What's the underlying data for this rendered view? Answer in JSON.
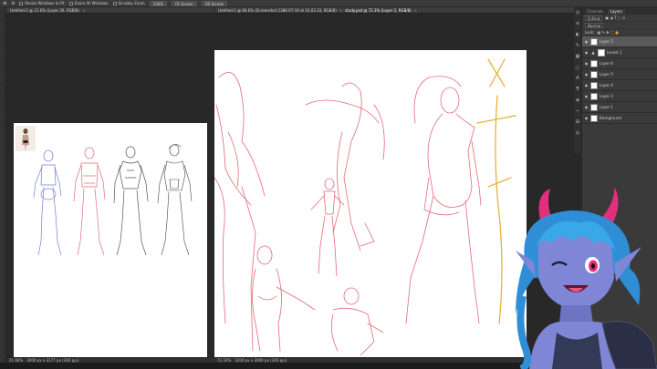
{
  "options_bar": {
    "items": [
      {
        "label": "Resize Windows to Fit",
        "kind": "checkbox"
      },
      {
        "label": "Zoom All Windows",
        "kind": "checkbox"
      },
      {
        "label": "Scrubby Zoom",
        "kind": "checkbox"
      },
      {
        "label": "100%",
        "kind": "button"
      },
      {
        "label": "Fit Screen",
        "kind": "button"
      },
      {
        "label": "Fill Screen",
        "kind": "button"
      }
    ]
  },
  "documents": [
    {
      "tab_title": "Untitled-2 @ 21.6% (Layer 26, RGB/8)",
      "status_zoom": "21.66%",
      "status_size": "3000 px x 3177 px (300 ppi)"
    },
    {
      "tab_title": "Untitled-1 @ 66.6% (Screenshot 2386-07-19 at 10.03.33, RGB/8)",
      "tab_title_2": "study.psd @ 72.3% (Layer 2, RGB/8)",
      "status_zoom": "72.33%",
      "status_size": "3200 px x 3000 px (300 ppi)"
    }
  ],
  "panels": {
    "tabs": [
      "Channels",
      "Layers"
    ],
    "active_tab": "Layers",
    "kind_filter": "Q Kind",
    "blend_mode": "Normal",
    "lock_label": "Lock:",
    "layers": [
      {
        "name": "Layer 2",
        "active": true,
        "type": "pixel"
      },
      {
        "name": "Levels 1",
        "active": false,
        "type": "adjustment"
      },
      {
        "name": "Layer 6",
        "active": false,
        "type": "pixel"
      },
      {
        "name": "Layer 5",
        "active": false,
        "type": "pixel"
      },
      {
        "name": "Layer 4",
        "active": false,
        "type": "pixel"
      },
      {
        "name": "Layer 3",
        "active": false,
        "type": "pixel"
      },
      {
        "name": "Layer 1",
        "active": false,
        "type": "pixel"
      },
      {
        "name": "Background",
        "active": false,
        "type": "pixel"
      }
    ]
  },
  "colors": {
    "app_bg": "#282828",
    "sketch_red": "#e36a78",
    "sketch_blue": "#7a7ccf",
    "sketch_gray": "#555555",
    "guide_yellow": "#e9b23a",
    "avatar_skin": "#7f86d6",
    "avatar_hair": "#3aa7e8",
    "avatar_horn": "#e0307e"
  }
}
